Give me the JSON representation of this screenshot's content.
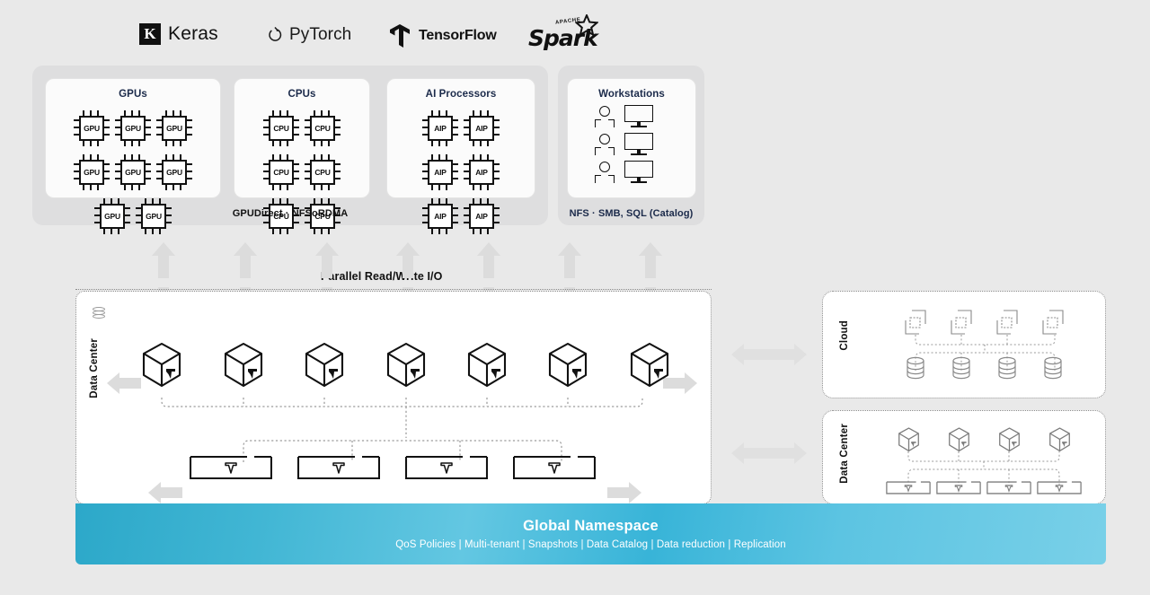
{
  "frameworks": [
    {
      "name": "Keras",
      "mark": "K",
      "icon": "keras-logo-icon"
    },
    {
      "name": "PyTorch",
      "icon": "pytorch-flame-icon"
    },
    {
      "name": "TensorFlow",
      "icon": "tensorflow-logo-icon"
    },
    {
      "name": "Spark",
      "superlabel": "APACHE",
      "icon": "apache-spark-logo-icon"
    }
  ],
  "compute": {
    "caption": "GPUDirect  ·  NFSoRDMA",
    "panels": [
      {
        "title": "GPUs",
        "chip_label": "GPU",
        "count": 8,
        "columns": 4
      },
      {
        "title": "CPUs",
        "chip_label": "CPU",
        "count": 6,
        "columns": 3
      },
      {
        "title": "AI Processors",
        "chip_label": "AIP",
        "count": 6,
        "columns": 3
      }
    ]
  },
  "workstations": {
    "title": "Workstations",
    "caption": "NFS · SMB, SQL (Catalog)",
    "seats": 3
  },
  "io": {
    "label": "Parallel Read/Write I/O",
    "arrow_count": 7,
    "direction": "bidirectional"
  },
  "datacenter_main": {
    "label": "Data Center",
    "node_count": 7,
    "node_icon": "vast-cube-icon",
    "storage_box_count": 4,
    "storage_icon": "vast-triangle-icon",
    "database_icon": "database-cylinder-icon"
  },
  "cloud_panel": {
    "label": "Cloud",
    "container_count": 4,
    "container_icon": "container-stack-icon",
    "database_count": 4,
    "database_icon": "database-cylinder-icon"
  },
  "datacenter_panel": {
    "label": "Data Center",
    "node_count": 4,
    "node_icon": "vast-cube-icon",
    "storage_box_count": 4,
    "storage_icon": "vast-triangle-icon"
  },
  "global_namespace": {
    "title": "Global Namespace",
    "features": [
      "QoS Policies",
      "Multi-tenant",
      "Snapshots",
      "Data Catalog",
      "Data reduction",
      "Replication"
    ],
    "subtitle": "QoS Policies   |   Multi-tenant  |  Snapshots   |   Data Catalog  | Data reduction | Replication"
  },
  "colors": {
    "background": "#e9e9e9",
    "panel_gray": "#dededf",
    "navy_text": "#1b2a4a",
    "banner_start": "#2ca8c9",
    "banner_end": "#79d0e8",
    "arrow_gray": "#dcdcdc",
    "dotted_border": "#8a8a8a"
  }
}
